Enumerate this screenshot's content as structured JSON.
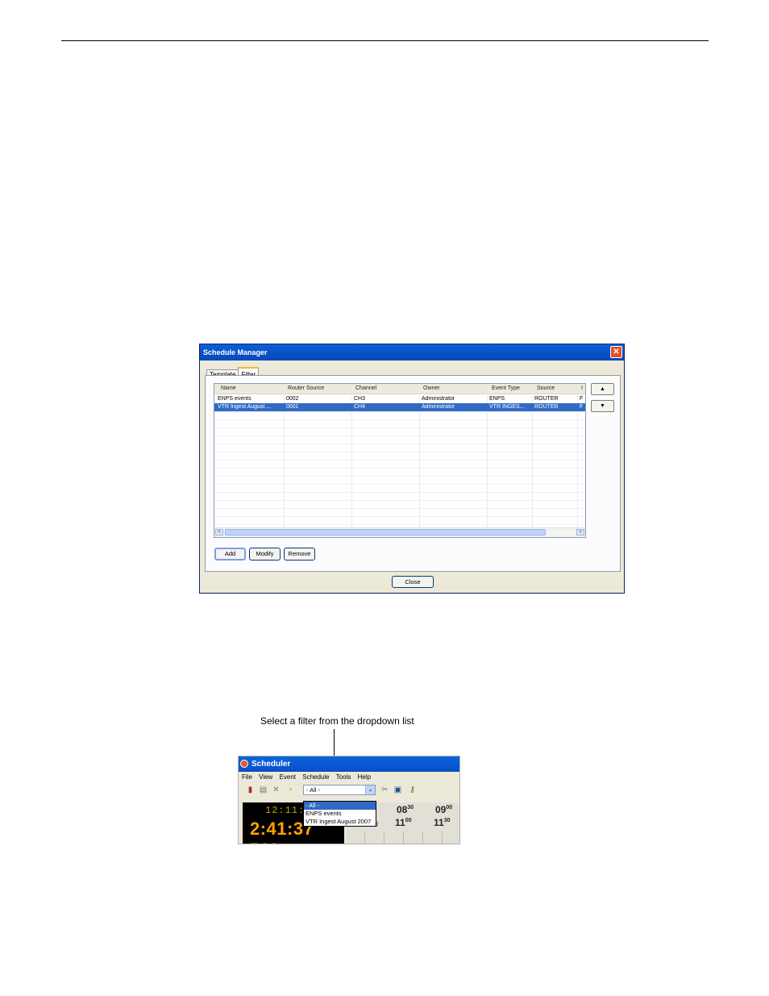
{
  "dialog": {
    "title": "Schedule Manager",
    "close_glyph": "✕",
    "tabs": [
      "Template",
      "Filter"
    ],
    "active_tab": "Filter",
    "columns": [
      "Name",
      "Router Source",
      "Channel",
      "Owner",
      "Event Type",
      "Source",
      "I"
    ],
    "rows": [
      {
        "name": "ENPS events",
        "router_source": "0002",
        "channel": "CH3",
        "owner": "Administrator",
        "event_type": "ENPS",
        "source": "ROUTER",
        "extra": "F",
        "selected": false
      },
      {
        "name": "VTR Ingest August ...",
        "router_source": "0001",
        "channel": "CH4",
        "owner": "Administrator",
        "event_type": "VTR INGES...",
        "source": "ROUTER",
        "extra": "F",
        "selected": true
      }
    ],
    "up_glyph": "▲",
    "down_glyph": "▼",
    "scroll_left_glyph": "<",
    "scroll_right_glyph": ">",
    "add_label": "Add",
    "modify_label": "Modify",
    "remove_label": "Remove",
    "close_label": "Close"
  },
  "callout": {
    "text": "Select a filter from the dropdown list"
  },
  "scheduler": {
    "title": "Scheduler",
    "menu": [
      "File",
      "View",
      "Event",
      "Schedule",
      "Tools",
      "Help"
    ],
    "filter_value": "- All -",
    "dropdown_arrow": "⌄",
    "dropdown_options": [
      "- All -",
      "ENPS events",
      "VTR Ingest August 2007"
    ],
    "selected_option": "- All -",
    "clock_small": "12:11:3",
    "clock_big": "2:41:37 PM",
    "timeline": [
      {
        "hour": "08",
        "min": "30"
      },
      {
        "hour": "09",
        "min": "00"
      },
      {
        "hour": "11",
        "min": "00"
      },
      {
        "hour": "11",
        "min": "30"
      }
    ],
    "timeline_partial": "0"
  }
}
